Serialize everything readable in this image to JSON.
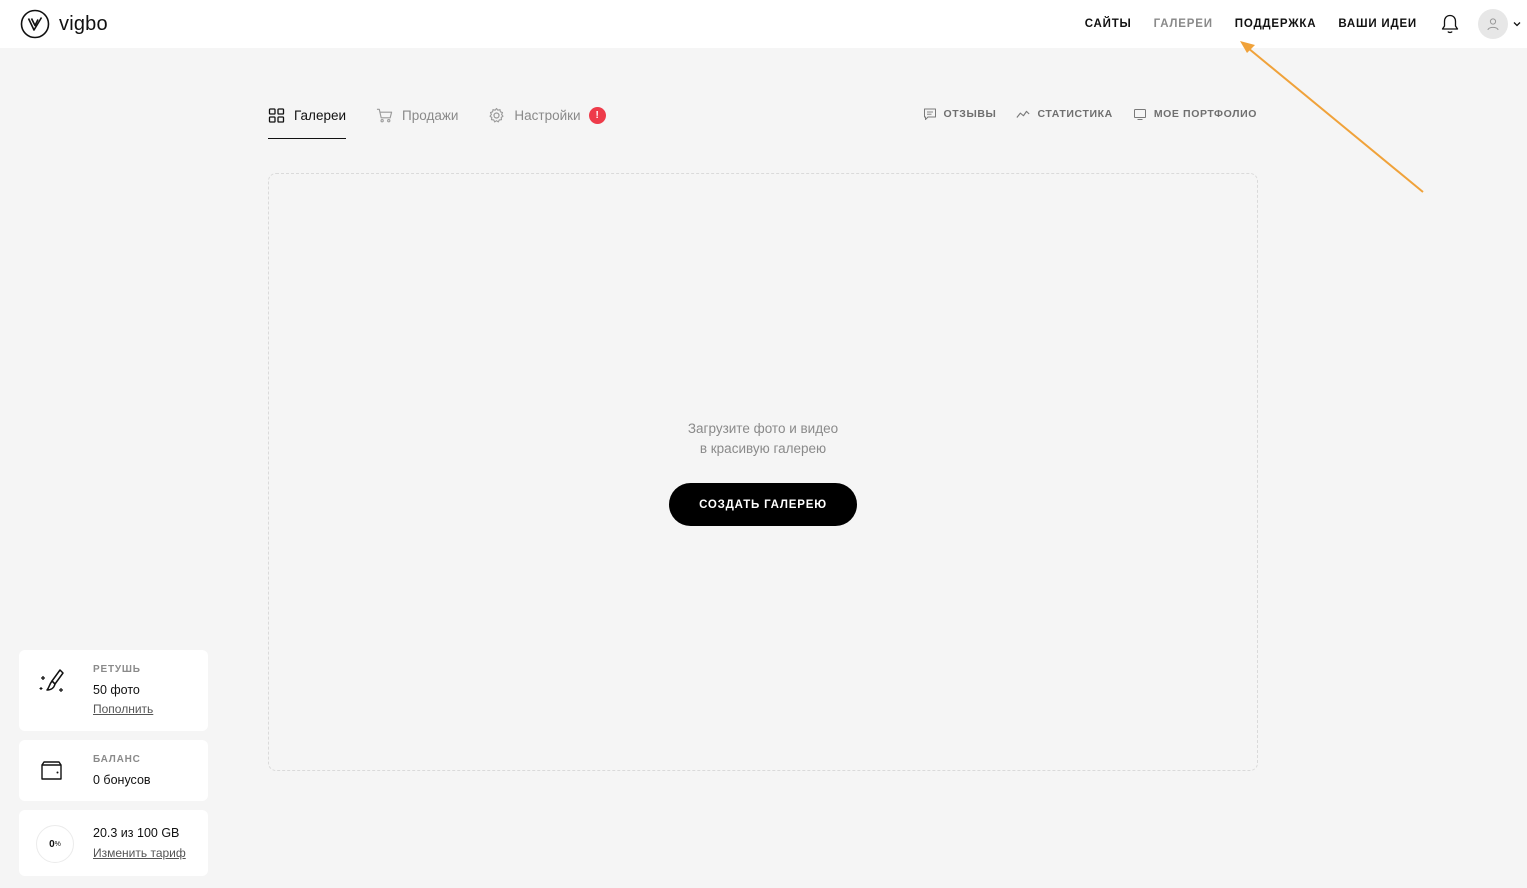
{
  "header": {
    "logo_text": "vigbo",
    "nav": [
      {
        "label": "САЙТЫ",
        "active": true
      },
      {
        "label": "ГАЛЕРЕИ",
        "active": false
      },
      {
        "label": "ПОДДЕРЖКА",
        "active": true
      },
      {
        "label": "ВАШИ ИДЕИ",
        "active": true
      }
    ]
  },
  "tabs": [
    {
      "label": "Галереи",
      "icon": "grid-icon",
      "active": true
    },
    {
      "label": "Продажи",
      "icon": "cart-icon",
      "active": false
    },
    {
      "label": "Настройки",
      "icon": "gear-icon",
      "active": false,
      "badge": "!"
    }
  ],
  "right_links": [
    {
      "label": "ОТЗЫВЫ",
      "icon": "comment-icon"
    },
    {
      "label": "СТАТИСТИКА",
      "icon": "chart-icon"
    },
    {
      "label": "МОЕ ПОРТФОЛИО",
      "icon": "monitor-icon"
    }
  ],
  "empty_state": {
    "line1": "Загрузите фото и видео",
    "line2": "в красивую галерею",
    "button": "СОЗДАТЬ ГАЛЕРЕЮ"
  },
  "cards": {
    "retouch": {
      "title": "РЕТУШЬ",
      "value": "50 фото",
      "link": "Пополнить"
    },
    "balance": {
      "title": "БАЛАНС",
      "value": "0 бонусов"
    },
    "storage": {
      "percent": "0",
      "percent_sign": "%",
      "value": "20.3 из 100 GB",
      "link": "Изменить тариф"
    }
  },
  "colors": {
    "accent_badge": "#ee3b4a",
    "annotation_arrow": "#f0a23a",
    "background": "#f5f5f5"
  }
}
